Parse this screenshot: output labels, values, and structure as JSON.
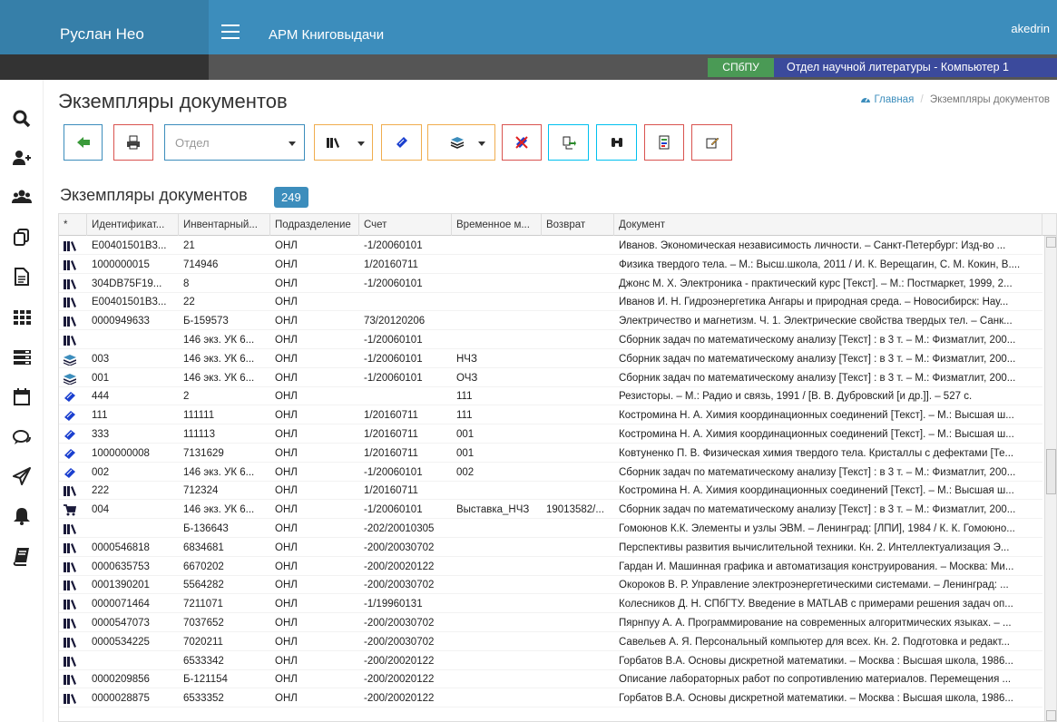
{
  "header": {
    "brand": "Руслан Нео",
    "app_title": "АРМ Книговыдачи",
    "username": "akedrin"
  },
  "subbar": {
    "org": "СПбПУ",
    "department": "Отдел научной литературы - Компьютер 1"
  },
  "sidebar": {
    "icons": [
      "search-icon",
      "add-user-icon",
      "users-icon",
      "copy-icon",
      "document-icon",
      "grid-icon",
      "list-icon",
      "calendar-icon",
      "comments-icon",
      "send-icon",
      "bell-icon",
      "book-icon"
    ]
  },
  "page": {
    "title": "Экземпляры документов",
    "breadcrumb_home": "Главная",
    "breadcrumb_sep": "/",
    "breadcrumb_current": "Экземпляры документов"
  },
  "toolbar": {
    "dept_placeholder": "Отдел"
  },
  "section": {
    "title": "Экземпляры документов",
    "count": "249"
  },
  "colors": {
    "header": "#3c8dbc",
    "org": "#4a9a55",
    "dept": "#3b4a9c"
  },
  "table": {
    "columns": [
      "*",
      "Идентификат...",
      "Инвентарный...",
      "Подразделение",
      "Счет",
      "Временное м...",
      "Возврат",
      "Документ"
    ],
    "rows": [
      {
        "icon": "books",
        "id": "E00401501B3...",
        "inv": "21",
        "dept": "ОНЛ",
        "acc": "-1/20060101",
        "temp": "",
        "ret": "",
        "doc": "Иванов. Экономическая независимость личности. – Санкт-Петербург: Изд-во ..."
      },
      {
        "icon": "books",
        "id": "1000000015",
        "inv": "714946",
        "dept": "ОНЛ",
        "acc": "1/20160711",
        "temp": "",
        "ret": "",
        "doc": "Физика твердого тела. – М.: Высш.школа, 2011 / И. К. Верещагин, С. М. Кокин, В...."
      },
      {
        "icon": "books",
        "id": "304DB75F19...",
        "inv": "8",
        "dept": "ОНЛ",
        "acc": "-1/20060101",
        "temp": "",
        "ret": "",
        "doc": "Джонс М. Х. Электроника - практический курс [Текст]. – М.: Постмаркет, 1999, 2..."
      },
      {
        "icon": "books",
        "id": "E00401501B3...",
        "inv": "22",
        "dept": "ОНЛ",
        "acc": "",
        "temp": "",
        "ret": "",
        "doc": "Иванов И. Н. Гидроэнергетика Ангары и природная среда. – Новосибирск: Нау..."
      },
      {
        "icon": "books",
        "id": "0000949633",
        "inv": "Б-159573",
        "dept": "ОНЛ",
        "acc": "73/20120206",
        "temp": "",
        "ret": "",
        "doc": "Электричество и магнетизм. Ч. 1. Электрические свойства твердых тел. – Санк..."
      },
      {
        "icon": "books",
        "id": "",
        "inv": "146 экз. УК 6...",
        "dept": "ОНЛ",
        "acc": "-1/20060101",
        "temp": "",
        "ret": "",
        "doc": "Сборник задач по математическому анализу [Текст] : в 3 т. – М.: Физматлит, 200..."
      },
      {
        "icon": "stack",
        "id": "003",
        "inv": "146 экз. УК 6...",
        "dept": "ОНЛ",
        "acc": "-1/20060101",
        "temp": "НЧЗ",
        "ret": "",
        "doc": "Сборник задач по математическому анализу [Текст] : в 3 т. – М.: Физматлит, 200..."
      },
      {
        "icon": "stack",
        "id": "001",
        "inv": "146 экз. УК 6...",
        "dept": "ОНЛ",
        "acc": "-1/20060101",
        "temp": "ОЧЗ",
        "ret": "",
        "doc": "Сборник задач по математическому анализу [Текст] : в 3 т. – М.: Физматлит, 200..."
      },
      {
        "icon": "book",
        "id": "444",
        "inv": "2",
        "dept": "ОНЛ",
        "acc": "",
        "temp": "111",
        "ret": "",
        "doc": "Резисторы. – М.: Радио и связь, 1991 / [В. В. Дубровский [и др.]]. – 527 с."
      },
      {
        "icon": "book",
        "id": "111",
        "inv": "111111",
        "dept": "ОНЛ",
        "acc": "1/20160711",
        "temp": "111",
        "ret": "",
        "doc": "Костромина Н. А. Химия координационных соединений [Текст]. – М.: Высшая ш..."
      },
      {
        "icon": "book",
        "id": "333",
        "inv": "111113",
        "dept": "ОНЛ",
        "acc": "1/20160711",
        "temp": "001",
        "ret": "",
        "doc": "Костромина Н. А. Химия координационных соединений [Текст]. – М.: Высшая ш..."
      },
      {
        "icon": "book",
        "id": "1000000008",
        "inv": "7131629",
        "dept": "ОНЛ",
        "acc": "1/20160711",
        "temp": "001",
        "ret": "",
        "doc": "Ковтуненко П. В. Физическая химия твердого тела. Кристаллы с дефектами [Те..."
      },
      {
        "icon": "book",
        "id": "002",
        "inv": "146 экз. УК 6...",
        "dept": "ОНЛ",
        "acc": "-1/20060101",
        "temp": "002",
        "ret": "",
        "doc": "Сборник задач по математическому анализу [Текст] : в 3 т. – М.: Физматлит, 200..."
      },
      {
        "icon": "books",
        "id": "222",
        "inv": "712324",
        "dept": "ОНЛ",
        "acc": "1/20160711",
        "temp": "",
        "ret": "",
        "doc": "Костромина Н. А. Химия координационных соединений [Текст]. – М.: Высшая ш..."
      },
      {
        "icon": "cart",
        "id": "004",
        "inv": "146 экз. УК 6...",
        "dept": "ОНЛ",
        "acc": "-1/20060101",
        "temp": "Выставка_НЧЗ",
        "ret": "19013582/...",
        "doc": "Сборник задач по математическому анализу [Текст] : в 3 т. – М.: Физматлит, 200..."
      },
      {
        "icon": "books",
        "id": "",
        "inv": "Б-136643",
        "dept": "ОНЛ",
        "acc": "-202/20010305",
        "temp": "",
        "ret": "",
        "doc": "Гомоюнов К.К. Элементы и узлы ЭВМ. – Ленинград: [ЛПИ], 1984 / К. К. Гомоюно..."
      },
      {
        "icon": "books",
        "id": "0000546818",
        "inv": "6834681",
        "dept": "ОНЛ",
        "acc": "-200/20030702",
        "temp": "",
        "ret": "",
        "doc": "Перспективы развития вычислительной техники. Кн. 2. Интеллектуализация Э..."
      },
      {
        "icon": "books",
        "id": "0000635753",
        "inv": "6670202",
        "dept": "ОНЛ",
        "acc": "-200/20020122",
        "temp": "",
        "ret": "",
        "doc": "Гардан И. Машинная графика и автоматизация конструирования. – Москва: Ми..."
      },
      {
        "icon": "books",
        "id": "0001390201",
        "inv": "5564282",
        "dept": "ОНЛ",
        "acc": "-200/20030702",
        "temp": "",
        "ret": "",
        "doc": "Окороков В. Р. Управление электроэнергетическими системами. – Ленинград: ..."
      },
      {
        "icon": "books",
        "id": "0000071464",
        "inv": "7211071",
        "dept": "ОНЛ",
        "acc": "-1/19960131",
        "temp": "",
        "ret": "",
        "doc": "Колесников Д. Н. СПбГТУ. Введение в MATLAB с примерами решения задач оп..."
      },
      {
        "icon": "books",
        "id": "0000547073",
        "inv": "7037652",
        "dept": "ОНЛ",
        "acc": "-200/20030702",
        "temp": "",
        "ret": "",
        "doc": "Пярнпуу А. А. Программирование на современных алгоритмических языках. – ..."
      },
      {
        "icon": "books",
        "id": "0000534225",
        "inv": "7020211",
        "dept": "ОНЛ",
        "acc": "-200/20030702",
        "temp": "",
        "ret": "",
        "doc": "Савельев А. Я. Персональный компьютер для всех. Кн. 2. Подготовка и редакт..."
      },
      {
        "icon": "books",
        "id": "",
        "inv": "6533342",
        "dept": "ОНЛ",
        "acc": "-200/20020122",
        "temp": "",
        "ret": "",
        "doc": "Горбатов В.А. Основы дискретной математики. – Москва : Высшая школа, 1986..."
      },
      {
        "icon": "books",
        "id": "0000209856",
        "inv": "Б-121154",
        "dept": "ОНЛ",
        "acc": "-200/20020122",
        "temp": "",
        "ret": "",
        "doc": "Описание лабораторных работ по сопротивлению материалов. Перемещения ..."
      },
      {
        "icon": "books",
        "id": "0000028875",
        "inv": "6533352",
        "dept": "ОНЛ",
        "acc": "-200/20020122",
        "temp": "",
        "ret": "",
        "doc": "Горбатов В.А. Основы дискретной математики. – Москва : Высшая школа, 1986..."
      }
    ]
  }
}
